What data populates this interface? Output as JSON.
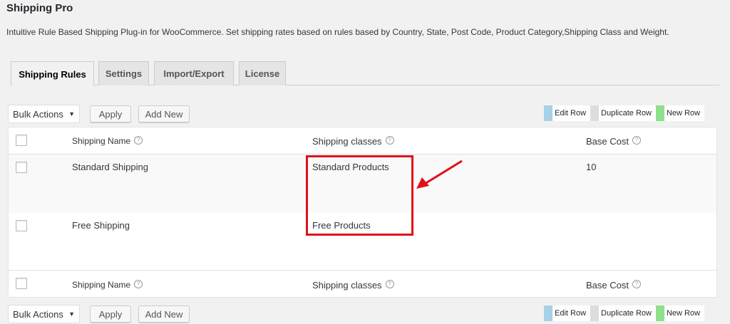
{
  "page": {
    "title": "Shipping Pro",
    "description": "Intuitive Rule Based Shipping Plug-in for WooCommerce. Set shipping rates based on rules based by Country, State, Post Code, Product Category,Shipping Class and Weight."
  },
  "tabs": [
    {
      "label": "Shipping Rules",
      "active": true
    },
    {
      "label": "Settings",
      "active": false
    },
    {
      "label": "Import/Export",
      "active": false
    },
    {
      "label": "License",
      "active": false
    }
  ],
  "toolbar": {
    "bulk_actions": "Bulk Actions",
    "apply": "Apply",
    "add_new": "Add New"
  },
  "legend": {
    "edit_row": "Edit Row",
    "duplicate_row": "Duplicate Row",
    "new_row": "New Row",
    "colors": {
      "edit": "#a7d1e6",
      "duplicate": "#dddddd",
      "new": "#8ee08b"
    }
  },
  "table": {
    "headers": {
      "shipping_name": "Shipping Name",
      "shipping_classes": "Shipping classes",
      "base_cost": "Base Cost"
    },
    "help_glyph": "?",
    "rows": [
      {
        "name": "Standard Shipping",
        "classes": "Standard Products",
        "base_cost": "10"
      },
      {
        "name": "Free Shipping",
        "classes": "Free Products",
        "base_cost": ""
      }
    ]
  },
  "annotation": {
    "highlight_color": "#e0101a"
  }
}
